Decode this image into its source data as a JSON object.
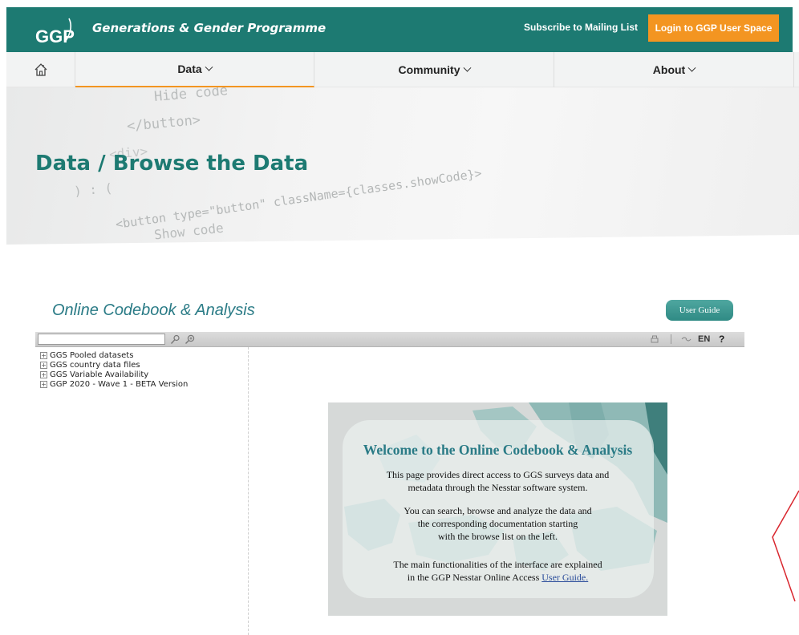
{
  "header": {
    "logo_text": "GGP",
    "site_title": "Generations & Gender Programme",
    "subscribe_label": "Subscribe to Mailing List",
    "login_label": "Login to GGP User Space",
    "colors": {
      "teal": "#1d7a72",
      "orange": "#f39521"
    }
  },
  "nav": {
    "home_icon": "home-icon",
    "items": [
      {
        "label": "Data"
      },
      {
        "label": "Community"
      },
      {
        "label": "About"
      }
    ]
  },
  "banner": {
    "title": "Data / Browse the Data",
    "code_lines": [
      "Hide code",
      "</button>",
      "<div>",
      ") : (",
      "<button type=\"button\" className={classes.showCode}>",
      "Show code"
    ]
  },
  "codebook": {
    "title": "Online Codebook & Analysis",
    "user_guide_label": "User Guide",
    "toolbar": {
      "search_value": "",
      "icons": [
        "search-icon",
        "advanced-search-icon",
        "print-icon",
        "link-icon"
      ],
      "language": "EN",
      "help": "?"
    },
    "tree": [
      {
        "label": "GGS Pooled datasets"
      },
      {
        "label": "GGS country data files"
      },
      {
        "label": "GGS Variable Availability"
      },
      {
        "label": "GGP 2020 - Wave 1 - BETA Version"
      }
    ],
    "welcome": {
      "title": "Welcome to the Online Codebook & Analysis",
      "p1_line1": "This page provides direct access to GGS surveys data and",
      "p1_line2": "metadata through the Nesstar software system.",
      "p2_line1": "You can search, browse and analyze the data and",
      "p2_line2": "the corresponding documentation starting",
      "p2_line3": "with the browse list on the left.",
      "p3_line1": "The main functionalities of the interface are explained",
      "p3_line2": "in the GGP Nesstar Online Access",
      "p3_link": "User Guide."
    }
  }
}
